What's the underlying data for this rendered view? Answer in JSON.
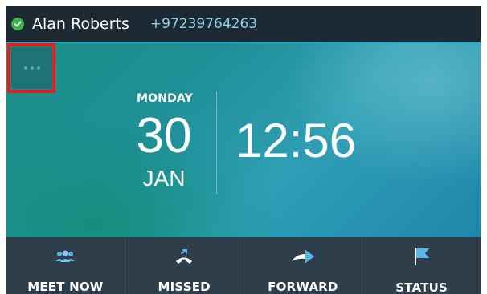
{
  "header": {
    "user_name": "Alan Roberts",
    "user_number": "+97239764263",
    "status_color": "#3cb44b",
    "status_icon": "check-icon"
  },
  "home": {
    "more_icon": "more-dots-icon",
    "day_name": "MONDAY",
    "day_number": "30",
    "month": "JAN",
    "time": "12:56"
  },
  "softkeys": [
    {
      "label": "MEET NOW",
      "icon": "people-icon"
    },
    {
      "label": "MISSED",
      "icon": "missed-call-icon"
    },
    {
      "label": "FORWARD",
      "icon": "forward-arrow-icon"
    },
    {
      "label": "STATUS",
      "icon": "flag-icon"
    }
  ],
  "colors": {
    "accent": "#2fa9c5",
    "icon_blue": "#5bb8e6",
    "highlight_red": "#e51f1f"
  }
}
